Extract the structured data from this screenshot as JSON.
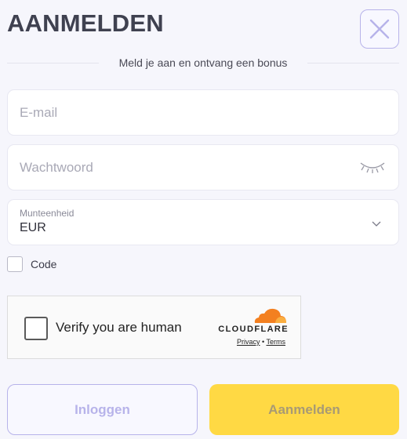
{
  "header": {
    "title": "AANMELDEN",
    "subtitle": "Meld je aan en ontvang een bonus"
  },
  "form": {
    "email_placeholder": "E-mail",
    "password_placeholder": "Wachtwoord",
    "currency": {
      "label": "Munteenheid",
      "value": "EUR"
    },
    "code_label": "Code"
  },
  "captcha": {
    "text": "Verify you are human",
    "brand": "CLOUDFLARE",
    "privacy": "Privacy",
    "separator": "•",
    "terms": "Terms"
  },
  "buttons": {
    "login": "Inloggen",
    "register": "Aanmelden"
  },
  "colors": {
    "accent_purple": "#b7b3ea",
    "accent_yellow": "#ffd944",
    "cloudflare_orange": "#f38020",
    "background": "#f6f6fc"
  },
  "icons": {
    "close": "close-icon",
    "password_toggle": "eye-closed-icon",
    "dropdown": "chevron-down-icon",
    "brand": "cloudflare-cloud-icon"
  }
}
